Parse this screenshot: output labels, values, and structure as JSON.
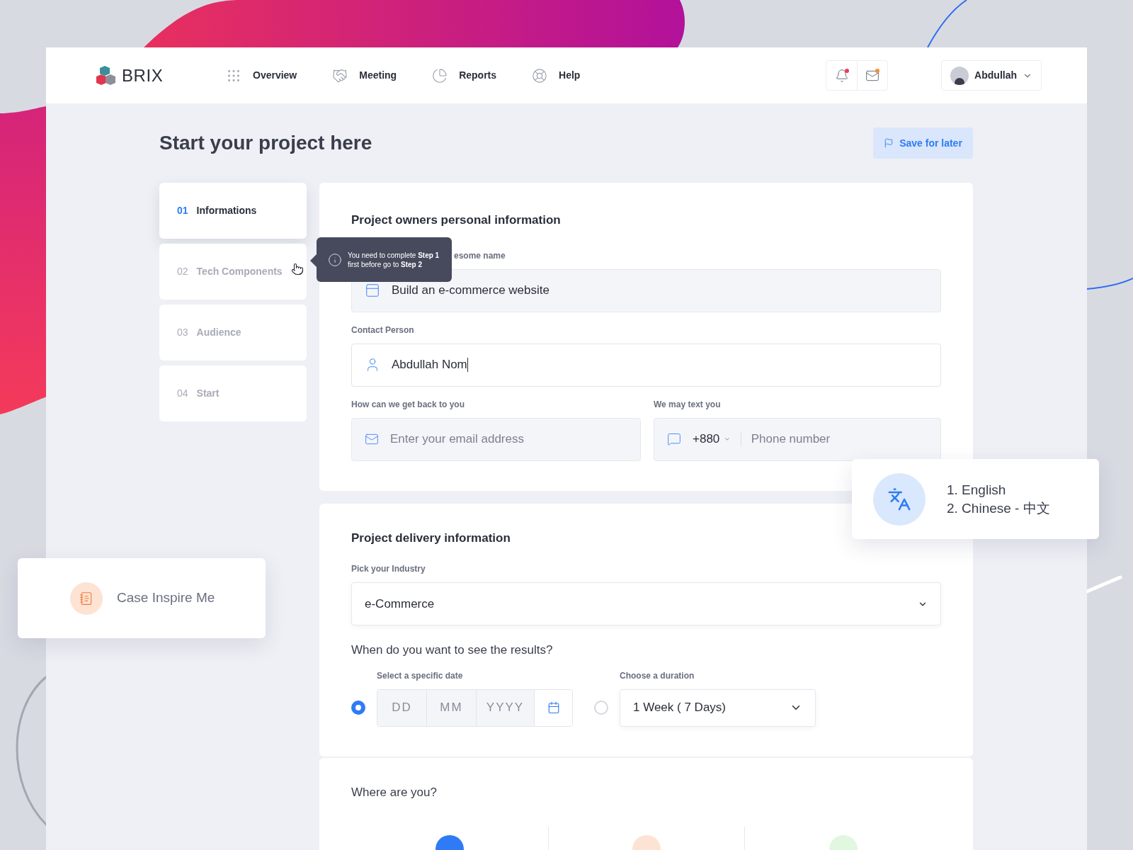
{
  "header": {
    "brand": "BRIX",
    "nav": [
      {
        "label": "Overview",
        "kind": "grid"
      },
      {
        "label": "Meeting",
        "kind": "handshake"
      },
      {
        "label": "Reports",
        "kind": "pie"
      },
      {
        "label": "Help",
        "kind": "help"
      }
    ],
    "alerts": [
      {
        "kind": "bell",
        "color": "#f5365c"
      },
      {
        "kind": "mail",
        "color": "#fb8c2d"
      }
    ],
    "user": {
      "name": "Abdullah"
    }
  },
  "page": {
    "title": "Start your project here",
    "save_button": "Save for later"
  },
  "steps": [
    {
      "number": "01",
      "label": "Informations",
      "selected": true
    },
    {
      "number": "02",
      "label": "Tech Components",
      "selected": false
    },
    {
      "number": "03",
      "label": "Audience",
      "selected": false
    },
    {
      "number": "04",
      "label": "Start",
      "selected": false
    }
  ],
  "tooltip": {
    "text": "You need to complete **Step 1** first before go to **Step 2**"
  },
  "owner_section": {
    "title": "Project owners personal information",
    "project_name": {
      "label": "esome name",
      "value": "Build an e-commerce website"
    },
    "contact": {
      "label": "Contact Person",
      "value": "Abdullah Nom"
    },
    "email": {
      "label": "How can we get back to you",
      "placeholder": "Enter your email address"
    },
    "phone": {
      "label": "We may text you",
      "code": "+880",
      "placeholder": "Phone number"
    }
  },
  "delivery_section": {
    "title": "Project delivery information",
    "industry": {
      "label": "Pick your Industry",
      "value": "e-Commerce"
    },
    "question": "When do you want to see the results?",
    "options": [
      {
        "kind": "date",
        "label": "Select a specific date",
        "selected": true,
        "parts": [
          "DD",
          "MM",
          "YYYY"
        ]
      },
      {
        "kind": "duration",
        "label": "Choose a duration",
        "selected": false,
        "value": "1 Week ( 7 Days)"
      }
    ]
  },
  "location_section": {
    "title": "Where are you?",
    "choices": [
      {
        "color": "#2f7bf6"
      },
      {
        "color": "#fde3d3"
      },
      {
        "color": "#e1f7df"
      }
    ]
  },
  "language_card": {
    "lines": [
      "1. English",
      "2. Chinese - 中文"
    ]
  },
  "case_card": {
    "label": "Case Inspire Me"
  }
}
